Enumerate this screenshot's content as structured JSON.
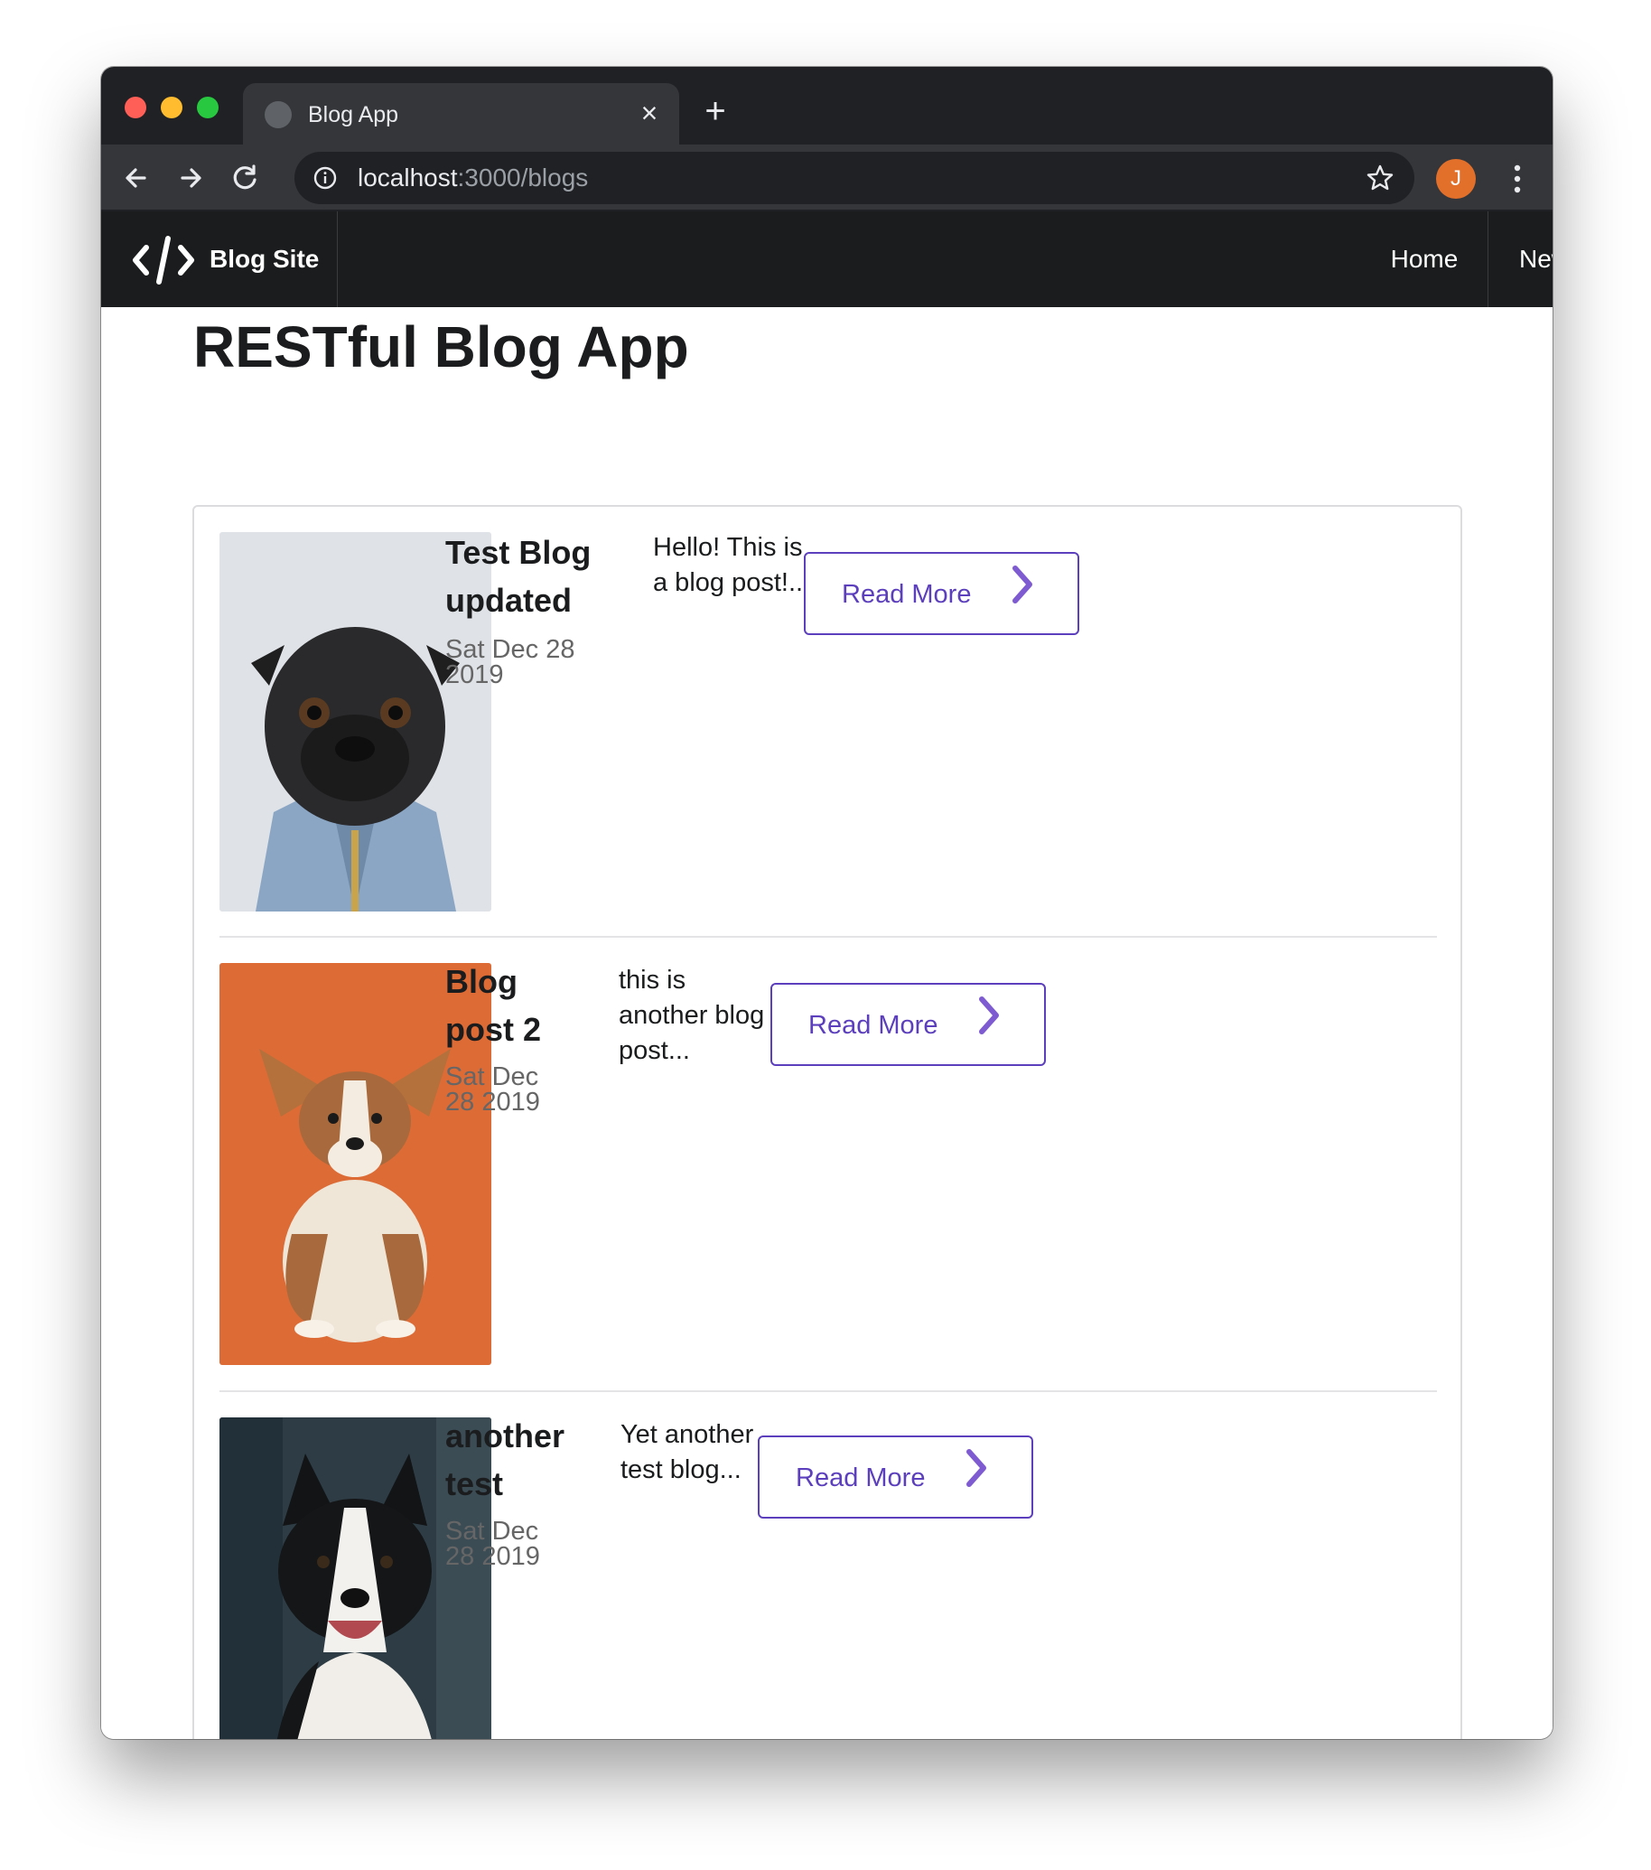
{
  "browser": {
    "tab_title": "Blog App",
    "tab_close_glyph": "×",
    "new_tab_glyph": "+",
    "url_host": "localhost",
    "url_path": ":3000/blogs",
    "profile_initial": "J",
    "profile_color": "#e2702b"
  },
  "navbar": {
    "brand": "Blog Site",
    "links": [
      "Home",
      "New Post"
    ]
  },
  "page": {
    "title": "RESTful Blog App"
  },
  "posts": [
    {
      "title_line1": "Test Blog",
      "title_line2": "updated",
      "date_line1": "Sat Dec 28",
      "date_line2": "2019",
      "excerpt_line1": "Hello! This is",
      "excerpt_line2": "a blog post!...",
      "excerpt_line3": "",
      "button": "Read More",
      "image": "pug-in-denim-jacket"
    },
    {
      "title_line1": "Blog",
      "title_line2": "post 2",
      "date_line1": "Sat Dec",
      "date_line2": "28 2019",
      "excerpt_line1": "this is",
      "excerpt_line2": "another blog",
      "excerpt_line3": "post...",
      "button": "Read More",
      "image": "corgi-puppy-orange-background"
    },
    {
      "title_line1": "another",
      "title_line2": "test",
      "date_line1": "Sat Dec",
      "date_line2": "28 2019",
      "excerpt_line1": "Yet another",
      "excerpt_line2": "test blog...",
      "excerpt_line3": "",
      "button": "Read More",
      "image": "border-collie"
    }
  ],
  "colors": {
    "accent": "#5b3fbc",
    "navbar_bg": "#1b1c1d",
    "browser_bg": "#202124"
  }
}
